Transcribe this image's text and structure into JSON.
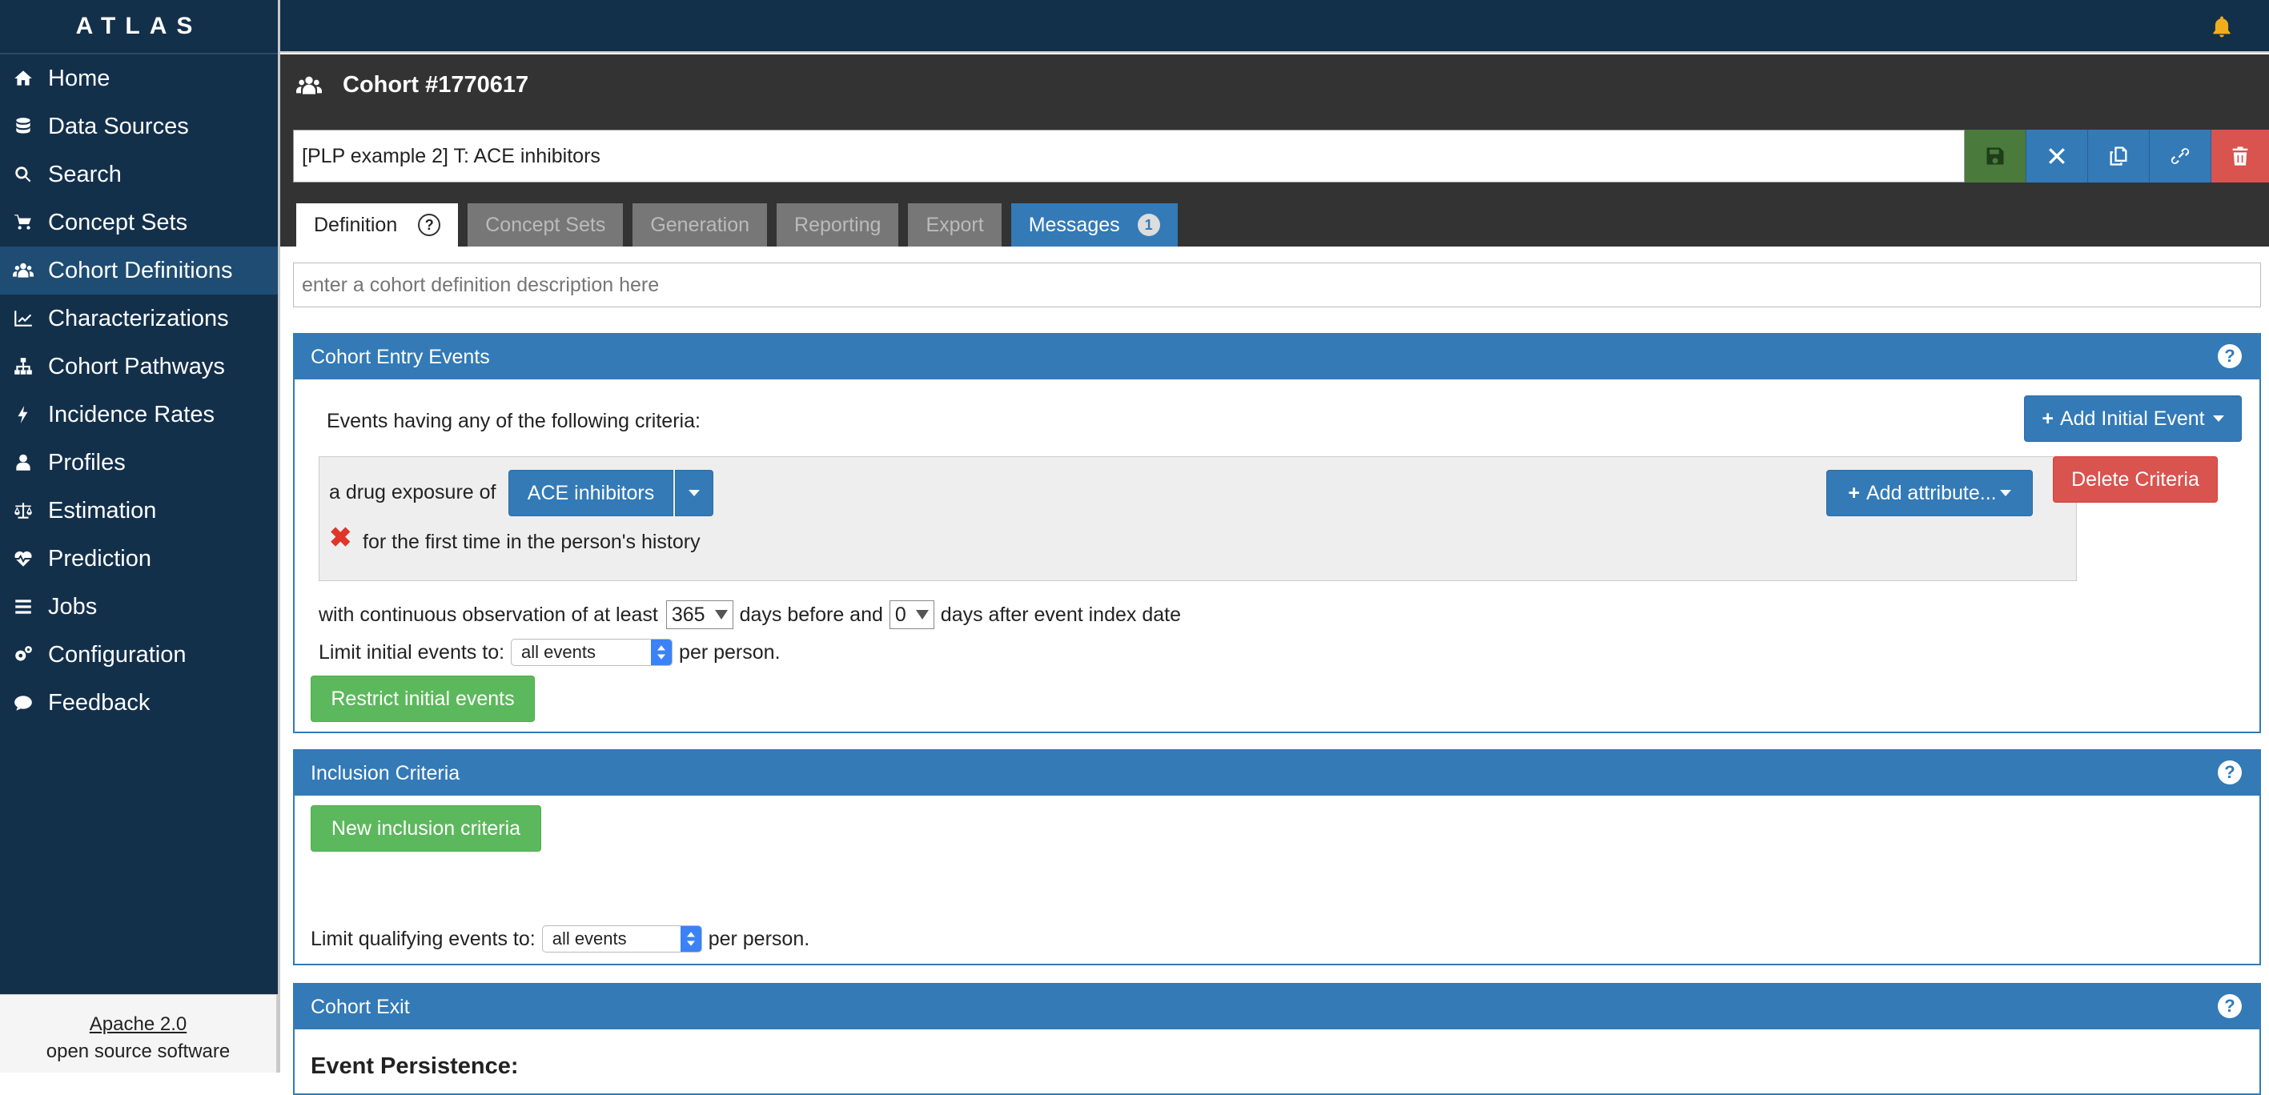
{
  "app": {
    "brand": "ATLAS"
  },
  "sidebar": {
    "items": [
      {
        "label": "Home",
        "icon": "home-icon"
      },
      {
        "label": "Data Sources",
        "icon": "database-icon"
      },
      {
        "label": "Search",
        "icon": "search-icon"
      },
      {
        "label": "Concept Sets",
        "icon": "shopping-cart-icon"
      },
      {
        "label": "Cohort Definitions",
        "icon": "users-icon",
        "active": true
      },
      {
        "label": "Characterizations",
        "icon": "line-chart-icon"
      },
      {
        "label": "Cohort Pathways",
        "icon": "sitemap-icon"
      },
      {
        "label": "Incidence Rates",
        "icon": "bolt-icon"
      },
      {
        "label": "Profiles",
        "icon": "user-icon"
      },
      {
        "label": "Estimation",
        "icon": "balance-scale-icon"
      },
      {
        "label": "Prediction",
        "icon": "heartbeat-icon"
      },
      {
        "label": "Jobs",
        "icon": "list-icon"
      },
      {
        "label": "Configuration",
        "icon": "cogs-icon"
      },
      {
        "label": "Feedback",
        "icon": "comment-icon"
      }
    ],
    "footer": {
      "license_link": "Apache 2.0",
      "license_text": "open source software"
    }
  },
  "header": {
    "title": "Cohort #1770617",
    "cohort_name": "[PLP example 2] T: ACE inhibitors",
    "tabs": [
      {
        "label": "Definition",
        "state": "active"
      },
      {
        "label": "Concept Sets",
        "state": "disabled"
      },
      {
        "label": "Generation",
        "state": "disabled"
      },
      {
        "label": "Reporting",
        "state": "disabled"
      },
      {
        "label": "Export",
        "state": "disabled"
      },
      {
        "label": "Messages",
        "state": "highlight",
        "badge": "1"
      }
    ],
    "help_glyph": "?"
  },
  "description": {
    "placeholder": "enter a cohort definition description here"
  },
  "entry_events": {
    "title": "Cohort Entry Events",
    "help": "?",
    "intro": "Events having any of the following criteria:",
    "add_initial_event": "Add Initial Event",
    "criteria": {
      "prefix": "a drug exposure of",
      "concept_set": "ACE inhibitors",
      "modifier": "for the first time in the person's history",
      "add_attribute": "Add attribute...",
      "delete": "Delete Criteria"
    },
    "observation": {
      "text1": "with continuous observation of at least",
      "before_days": "365",
      "text2": "days before and",
      "after_days": "0",
      "text3": "days after event index date"
    },
    "limit": {
      "label": "Limit initial events to:",
      "value": "all events",
      "suffix": "per person."
    },
    "restrict_button": "Restrict initial events"
  },
  "inclusion": {
    "title": "Inclusion Criteria",
    "help": "?",
    "new_button": "New inclusion criteria",
    "limit": {
      "label": "Limit qualifying events to:",
      "value": "all events",
      "suffix": "per person."
    }
  },
  "exit": {
    "title": "Cohort Exit",
    "help": "?",
    "subtitle": "Event Persistence:"
  },
  "colors": {
    "nav_bg": "#13304b",
    "primary": "#337ab7",
    "success": "#5cb85c",
    "danger": "#d9534f"
  }
}
